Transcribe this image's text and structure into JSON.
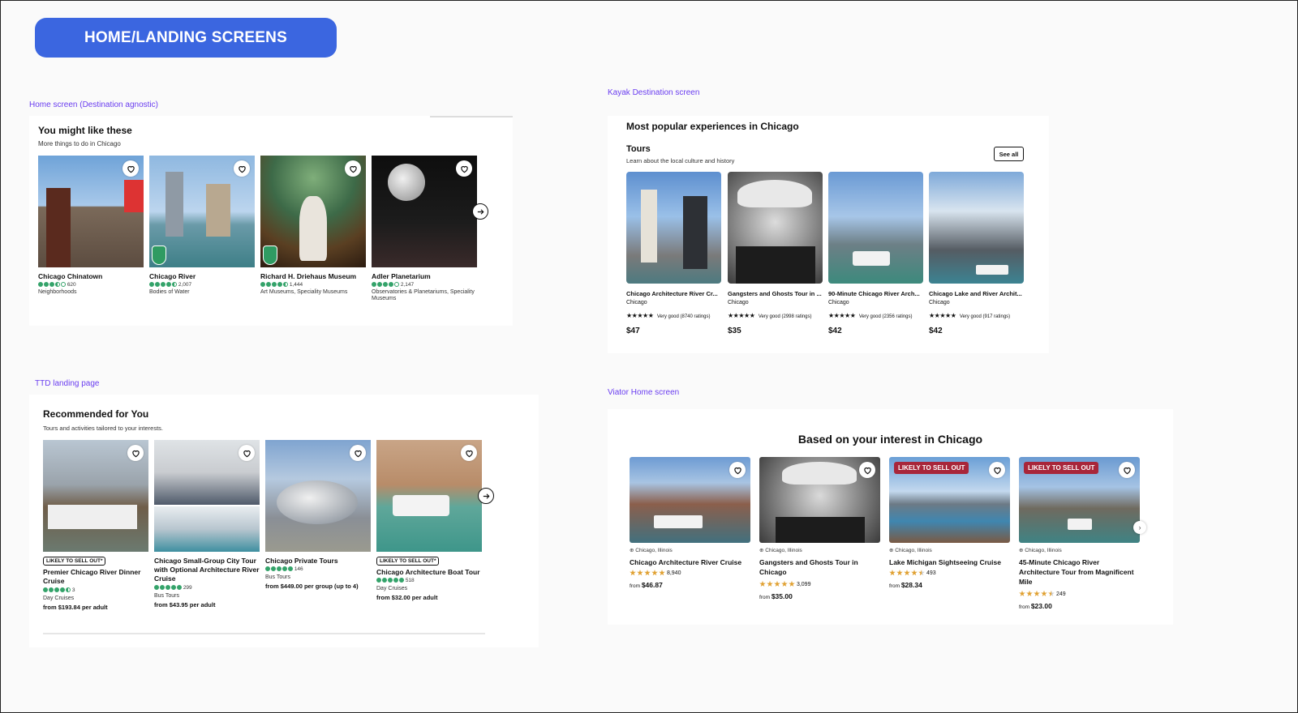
{
  "header": {
    "title": "HOME/LANDING SCREENS"
  },
  "captions": {
    "home": "Home screen (Destination agnostic)",
    "kayak": "Kayak Destination screen",
    "ttd": "TTD landing page",
    "viator": "Viator Home screen"
  },
  "home": {
    "title": "You might like these",
    "subtitle": "More things to do in Chicago",
    "cards": [
      {
        "name": "Chicago Chinatown",
        "reviews": "620",
        "category": "Neighborhoods",
        "rating": 3.5,
        "award": false
      },
      {
        "name": "Chicago River",
        "reviews": "2,007",
        "category": "Bodies of Water",
        "rating": 4.5,
        "award": true
      },
      {
        "name": "Richard H. Driehaus Museum",
        "reviews": "1,444",
        "category": "Art Museums, Speciality Museums",
        "rating": 4.5,
        "award": true
      },
      {
        "name": "Adler Planetarium",
        "reviews": "2,147",
        "category": "Observatories & Planetariums, Speciality Museums",
        "rating": 4.0,
        "award": false
      }
    ]
  },
  "kayak": {
    "title": "Most popular experiences in Chicago",
    "section": "Tours",
    "section_sub": "Learn about the local culture and history",
    "see_all": "See all",
    "cards": [
      {
        "name": "Chicago Architecture River Cr...",
        "location": "Chicago",
        "rating_text": "Very good (8740 ratings)",
        "price": "$47"
      },
      {
        "name": "Gangsters and Ghosts Tour in ...",
        "location": "Chicago",
        "rating_text": "Very good (2998 ratings)",
        "price": "$35"
      },
      {
        "name": "90-Minute Chicago River Arch...",
        "location": "Chicago",
        "rating_text": "Very good (2356 ratings)",
        "price": "$42"
      },
      {
        "name": "Chicago Lake and River Archit...",
        "location": "Chicago",
        "rating_text": "Very good (917 ratings)",
        "price": "$42"
      }
    ]
  },
  "ttd": {
    "title": "Recommended for You",
    "subtitle": "Tours and activities tailored to your interests.",
    "cards": [
      {
        "badge": "LIKELY TO SELL OUT*",
        "name": "Premier Chicago River Dinner Cruise",
        "reviews": "3",
        "category": "Day Cruises",
        "price": "from $193.84 per adult"
      },
      {
        "badge": "",
        "name": "Chicago Small-Group City Tour with Optional Architecture River Cruise",
        "reviews": "299",
        "category": "Bus Tours",
        "price": "from $43.95 per adult"
      },
      {
        "badge": "",
        "name": "Chicago Private Tours",
        "reviews": "146",
        "category": "Bus Tours",
        "price": "from $449.00 per group (up to 4)"
      },
      {
        "badge": "LIKELY TO SELL OUT*",
        "name": "Chicago Architecture Boat Tour",
        "reviews": "518",
        "category": "Day Cruises",
        "price": "from $32.00 per adult"
      }
    ]
  },
  "viator": {
    "title": "Based on your interest in Chicago",
    "cards": [
      {
        "badge": "",
        "location": "Chicago, Illinois",
        "name": "Chicago Architecture River Cruise",
        "reviews": "8,940",
        "from": "from",
        "price": "$46.87",
        "rating": 5
      },
      {
        "badge": "",
        "location": "Chicago, Illinois",
        "name": "Gangsters and Ghosts Tour in Chicago",
        "reviews": "3,099",
        "from": "from",
        "price": "$35.00",
        "rating": 5
      },
      {
        "badge": "LIKELY TO SELL OUT",
        "location": "Chicago, Illinois",
        "name": "Lake Michigan Sightseeing Cruise",
        "reviews": "493",
        "from": "from",
        "price": "$28.34",
        "rating": 4.5
      },
      {
        "badge": "LIKELY TO SELL OUT",
        "location": "Chicago, Illinois",
        "name": "45-Minute Chicago River Architecture Tour from Magnificent Mile",
        "reviews": "249",
        "from": "from",
        "price": "$23.00",
        "rating": 4.5
      }
    ]
  },
  "colors": {
    "accent": "#3b66e0",
    "caption": "#6a3df0",
    "tripadvisor_green": "#34a36a",
    "viator_star": "#e0a030",
    "sellout": "#a8263a"
  }
}
